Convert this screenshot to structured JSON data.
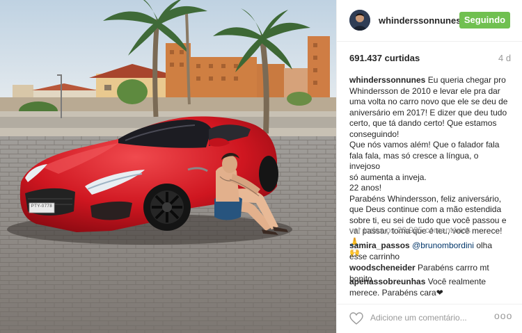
{
  "post": {
    "username": "whinderssonnunes",
    "follow_label": "Seguindo",
    "likes": "691.437 curtidas",
    "age": "4 d",
    "caption": {
      "username": "whinderssonnunes",
      "lines": [
        "Eu queria chegar pro",
        "Whindersson de 2010 e levar ele pra dar",
        "uma volta no carro novo que ele se deu de",
        "aniversário em 2017! E dizer que deu tudo",
        "certo, que tá dando certo! Que estamos",
        "conseguindo!",
        "Que nós vamos além! Que o falador fala",
        "fala fala, mas só cresce a língua, o invejoso",
        "só aumenta a inveja.",
        "22 anos!",
        "Parabéns Whindersson, feliz aniversário,",
        "que Deus continue com a mão estendida",
        "sobre ti, eu sei de tudo que você passou e",
        "vai passar, toma que é teu, você merece! 🙏",
        "🙌"
      ]
    },
    "view_all": "ver todos os 20.925 comentários",
    "comments": [
      {
        "user": "samira_passos",
        "mention": "@brunombordini",
        "text": " olha esse carrinho"
      },
      {
        "user": "woodscheneider",
        "mention": "",
        "text": " Parabéns carrro mt bonito"
      },
      {
        "user": "apenassobreunhas",
        "mention": "",
        "text": " Você realmente merece. Parabéns cara❤"
      }
    ],
    "add_comment_placeholder": "Adicione um comentário...",
    "more_label": "ooo"
  },
  "photo": {
    "plate": "PTY-0778",
    "colors": {
      "sky": "#cfdde8",
      "car": "#d8141f",
      "pavement": "#8a8580",
      "accent_follow": "#70c050"
    }
  }
}
